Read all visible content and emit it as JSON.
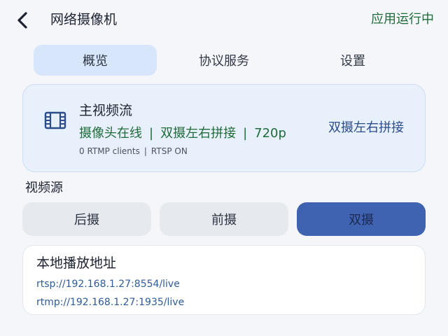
{
  "header": {
    "back_icon": "chevron-left-icon",
    "title": "网络摄像机",
    "status": "应用运行中",
    "status_color": "#1f6b3a"
  },
  "tabs": [
    {
      "label": "概览",
      "active": true
    },
    {
      "label": "协议服务",
      "active": false
    },
    {
      "label": "设置",
      "active": false
    }
  ],
  "stream": {
    "icon": "film-icon",
    "title": "主视频流",
    "status_parts": [
      "摄像头在线",
      "双摄左右拼接",
      "720p"
    ],
    "separator": "|",
    "sub_parts": [
      "0 RTMP clients",
      "RTSP ON"
    ],
    "mode_label": "双摄左右拼接"
  },
  "video_source": {
    "label": "视频源",
    "options": [
      {
        "label": "后摄",
        "selected": false
      },
      {
        "label": "前摄",
        "selected": false
      },
      {
        "label": "双摄",
        "selected": true
      }
    ],
    "selected_color": "#3f63b0"
  },
  "local_address": {
    "title": "本地播放地址",
    "urls": [
      "rtsp://192.168.1.27:8554/live",
      "rtmp://192.168.1.27:1935/live"
    ]
  }
}
